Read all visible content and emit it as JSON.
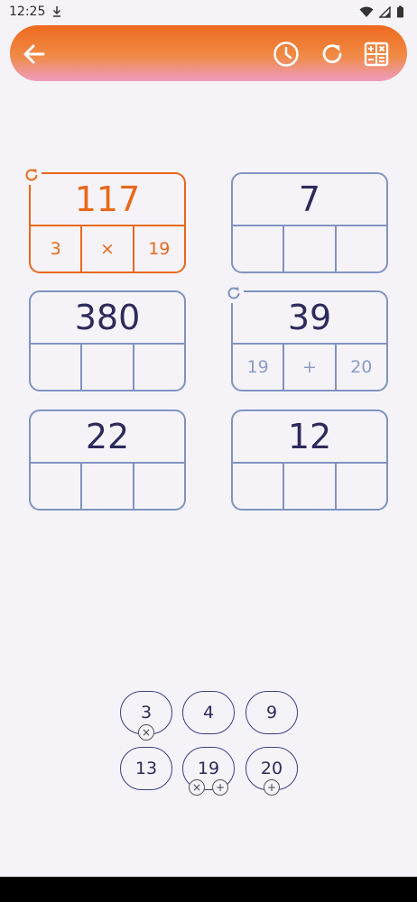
{
  "status": {
    "time": "12:25"
  },
  "cards": [
    {
      "target": "117",
      "left": "3",
      "op": "×",
      "right": "19"
    },
    {
      "target": "7",
      "left": "",
      "op": "",
      "right": ""
    },
    {
      "target": "380",
      "left": "",
      "op": "",
      "right": ""
    },
    {
      "target": "39",
      "left": "19",
      "op": "+",
      "right": "20"
    },
    {
      "target": "22",
      "left": "",
      "op": "",
      "right": ""
    },
    {
      "target": "12",
      "left": "",
      "op": "",
      "right": ""
    }
  ],
  "numbers": [
    {
      "value": "3",
      "ops": [
        "×"
      ]
    },
    {
      "value": "4",
      "ops": []
    },
    {
      "value": "9",
      "ops": []
    },
    {
      "value": "13",
      "ops": []
    },
    {
      "value": "19",
      "ops": [
        "×",
        "+"
      ]
    },
    {
      "value": "20",
      "ops": [
        "+"
      ]
    }
  ],
  "colors": {
    "accent": "#e8681a",
    "card_border": "#7f93c0",
    "text_dark": "#2d2a5c",
    "background": "#f6f3f8"
  },
  "icons": {
    "back": "arrow-left-icon",
    "history": "clock-icon",
    "refresh": "refresh-icon",
    "calculator": "calculator-icon"
  }
}
